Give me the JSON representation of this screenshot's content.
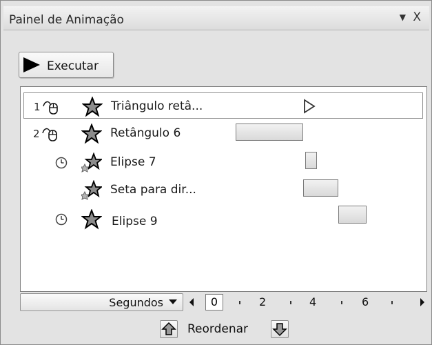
{
  "panel": {
    "title": "Painel de Animação",
    "dropdown_icon": "dropdown-arrow-icon",
    "close_label": "X"
  },
  "run_button": {
    "label": "Executar",
    "icon": "play-icon"
  },
  "animations": [
    {
      "order": "1",
      "trigger": "on-click",
      "effect": "emphasis-star",
      "label": "Triângulo retâ...",
      "selected": true
    },
    {
      "order": "2",
      "trigger": "on-click",
      "effect": "emphasis-star",
      "label": "Retângulo 6",
      "selected": false
    },
    {
      "order": "",
      "trigger": "after-previous",
      "effect": "motion-star",
      "label": "Elipse 7",
      "selected": false
    },
    {
      "order": "",
      "trigger": "with-previous",
      "effect": "motion-star",
      "label": "Seta para dir...",
      "selected": false
    },
    {
      "order": "",
      "trigger": "after-previous",
      "effect": "emphasis-star",
      "label": "Elipse 9",
      "selected": false
    }
  ],
  "timeline": {
    "unit_label": "Segundos",
    "ticks": [
      "0",
      "2",
      "4",
      "6"
    ]
  },
  "reorder": {
    "label": "Reordenar",
    "up_icon": "arrow-up-icon",
    "down_icon": "arrow-down-icon"
  },
  "colors": {
    "background": "#e3e3e3",
    "list_bg": "#ffffff",
    "bar_fill": "#e2e2e2"
  }
}
